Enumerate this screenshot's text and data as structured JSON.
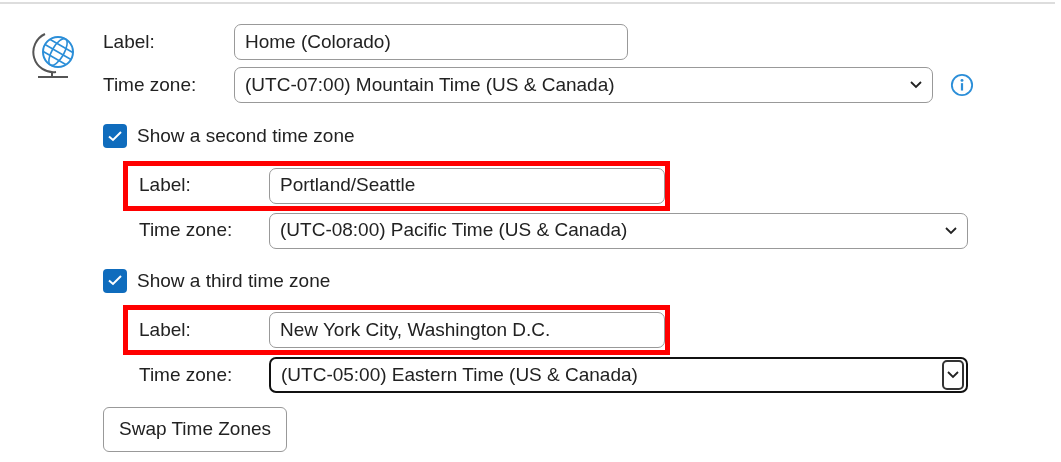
{
  "home": {
    "label_caption": "Label:",
    "label_value": "Home (Colorado)",
    "zone_caption": "Time zone:",
    "zone_value": "(UTC-07:00) Mountain Time (US & Canada)"
  },
  "extra_zones": [
    {
      "toggle": "Show a second time zone",
      "checked": true,
      "label_caption": "Label:",
      "label_value": "Portland/Seattle",
      "highlighted": true,
      "zone_caption": "Time zone:",
      "zone_value": "(UTC-08:00) Pacific Time (US & Canada)",
      "focused": false
    },
    {
      "toggle": "Show a third time zone",
      "checked": true,
      "label_caption": "Label:",
      "label_value": "New York City, Washington D.C.",
      "highlighted": true,
      "zone_caption": "Time zone:",
      "zone_value": "(UTC-05:00) Eastern Time (US & Canada)",
      "focused": true
    }
  ],
  "swap_button": "Swap Time Zones"
}
